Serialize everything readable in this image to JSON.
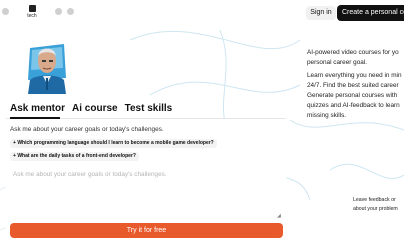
{
  "nav": {
    "logo_text": "tech",
    "signin_label": "Sign in",
    "create_label": "Create a personal cou"
  },
  "tabs": [
    {
      "label": "Ask mentor",
      "active": true
    },
    {
      "label": "Ai course",
      "active": false
    },
    {
      "label": "Test skills",
      "active": false
    }
  ],
  "ask": {
    "prompt": "Ask me about your career goals or today's challenges.",
    "suggestions": [
      "Which programming language should I learn to become a mobile game developer?",
      "What are the daily tasks of a front-end developer?"
    ],
    "placeholder": "Ask me about your career goals or today's challenges.",
    "cta_label": "Try it for free"
  },
  "description": {
    "paragraph1": "AI-powered video courses for yo\npersonal career goal.",
    "paragraph2_lines": [
      "Learn everything you need in min",
      "24/7. Find the best suited career",
      "Generate personal courses with",
      "quizzes and AI-feedback to learn",
      "missing skills."
    ]
  },
  "feedback": {
    "line1": "Leave feedback or",
    "line2": "about your problem"
  },
  "colors": {
    "cta": "#e8592c",
    "create_button": "#111111",
    "mentor_bg": "#3aa0d8"
  }
}
